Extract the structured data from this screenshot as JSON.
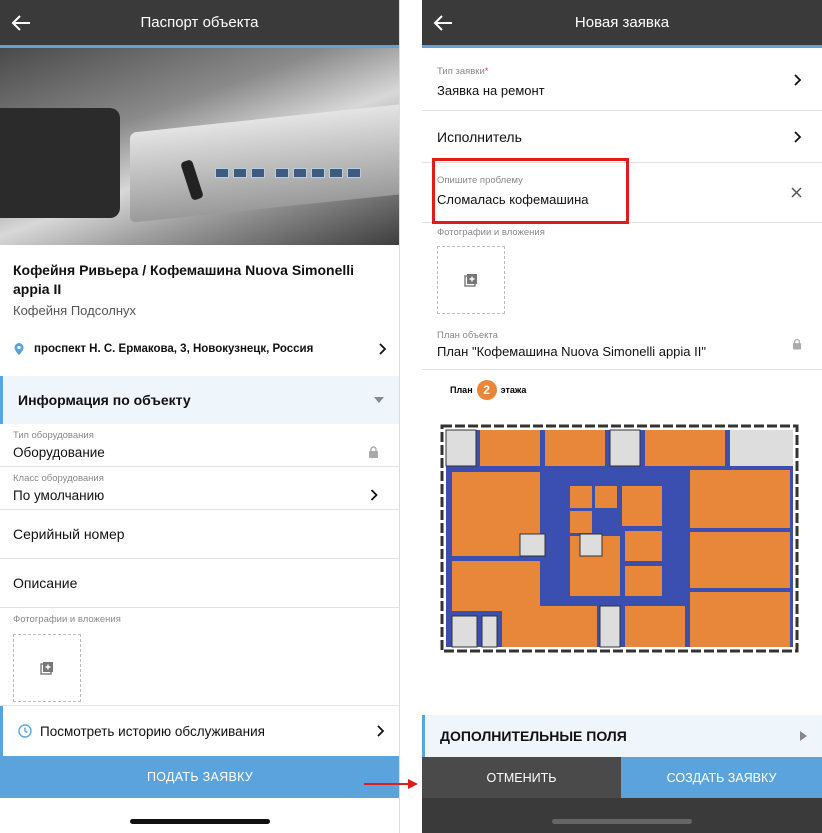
{
  "left": {
    "title": "Паспорт объекта",
    "object_name": "Кофейня Ривьера / Кофемашина Nuova Simonelli appia II",
    "object_sub": "Кофейня Подсолнух",
    "address": "проспект Н. С. Ермакова, 3, Новокузнецк, Россия",
    "section_title": "Информация по объекту",
    "fields": [
      {
        "label": "Тип оборудования",
        "value": "Оборудование",
        "icon": "lock-icon"
      },
      {
        "label": "Класс оборудования",
        "value": "По умолчанию",
        "icon": "chevron-right-icon"
      }
    ],
    "serial": "Серийный номер",
    "description": "Описание",
    "photos_label": "Фотографии и вложения",
    "history": "Посмотреть историю обслуживания",
    "submit": "ПОДАТЬ ЗАЯВКУ"
  },
  "right": {
    "title": "Новая заявка",
    "type_label": "Тип заявки",
    "type_required": "*",
    "type_value": "Заявка на ремонт",
    "executor": "Исполнитель",
    "problem_label": "Опишите проблему",
    "problem_value": "Сломалась кофемашина",
    "photos_label": "Фотографии и вложения",
    "plan_label": "План объекта",
    "plan_value": "План \"Кофемашина Nuova Simonelli appia II\"",
    "floor_prefix": "План",
    "floor_num": "2",
    "floor_suffix": "этажа",
    "extra_fields": "ДОПОЛНИТЕЛЬНЫЕ ПОЛЯ",
    "cancel": "ОТМЕНИТЬ",
    "create": "СОЗДАТЬ ЗАЯВКУ"
  },
  "colors": {
    "accent": "#5ba3dc",
    "topbar": "#3a3a3a",
    "highlight": "#e21b1b",
    "plan_room": "#e8873a",
    "plan_corridor": "#3a4fb0"
  }
}
